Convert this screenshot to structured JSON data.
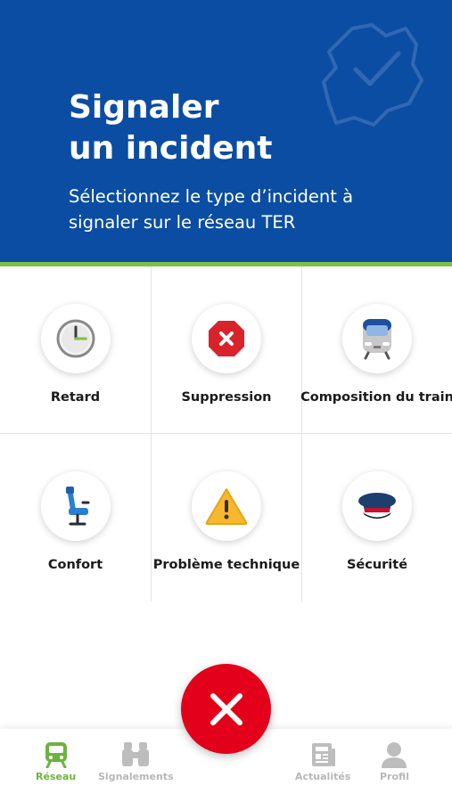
{
  "header": {
    "title_line1": "Signaler",
    "title_line2": "un incident",
    "subtitle": "Sélectionnez le type d’incident à signaler sur le réseau TER"
  },
  "incident_types": [
    {
      "label": "Retard",
      "icon": "clock-icon"
    },
    {
      "label": "Suppression",
      "icon": "cancel-octagon-icon"
    },
    {
      "label": "Composition du train",
      "icon": "train-front-icon"
    },
    {
      "label": "Confort",
      "icon": "seat-icon"
    },
    {
      "label": "Problème technique",
      "icon": "warning-icon"
    },
    {
      "label": "Sécurité",
      "icon": "officer-cap-icon"
    }
  ],
  "close_button": {
    "icon": "close-icon"
  },
  "tabbar": {
    "tabs": [
      {
        "label": "Réseau",
        "icon": "train-icon",
        "active": true
      },
      {
        "label": "Signalements",
        "icon": "binoculars-icon",
        "active": false
      },
      {
        "label": "Actualités",
        "icon": "newspaper-icon",
        "active": false
      },
      {
        "label": "Profil",
        "icon": "user-icon",
        "active": false
      }
    ]
  },
  "colors": {
    "header_bg": "#0b4da2",
    "accent_green": "#7cc142",
    "active_tab": "#6cb33f",
    "close_red": "#e2001a",
    "inactive_tab": "#b7b7b7"
  }
}
